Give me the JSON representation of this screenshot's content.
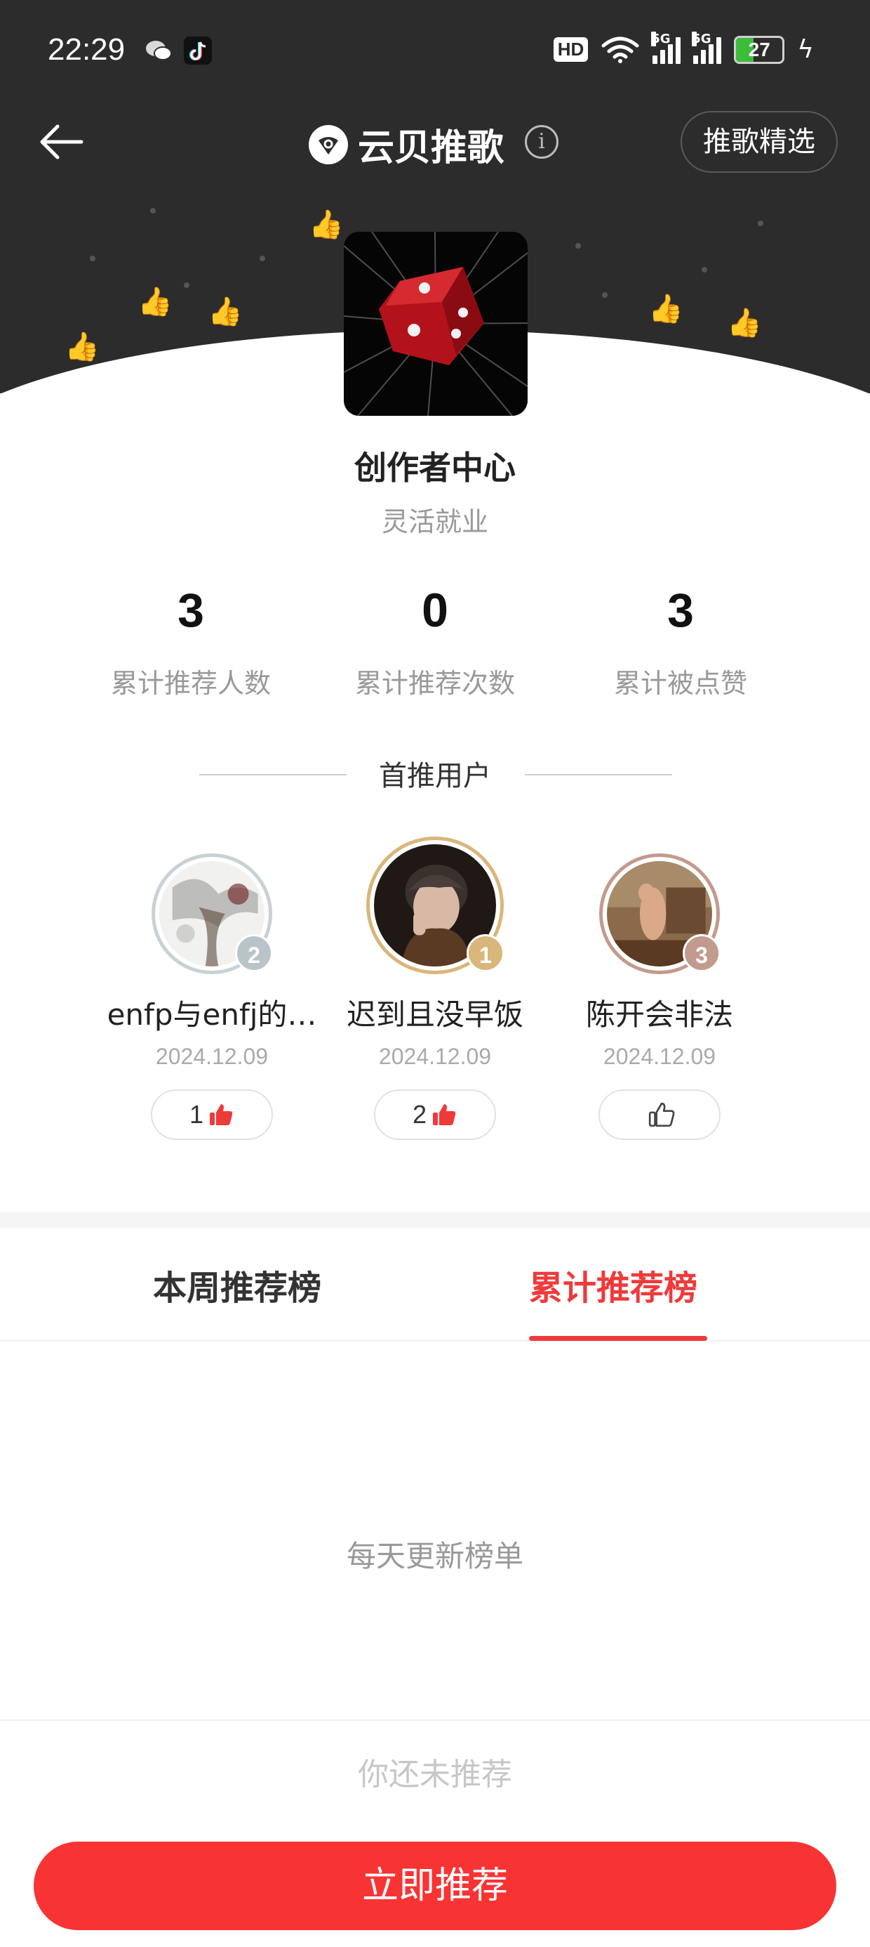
{
  "status_bar": {
    "time": "22:29",
    "hd_label": "HD",
    "network_1": "5G",
    "network_2": "5G",
    "battery": "27"
  },
  "nav": {
    "title": "云贝推歌",
    "pick_button": "推歌精选"
  },
  "creator": {
    "title": "创作者中心",
    "subtitle": "灵活就业"
  },
  "stats": [
    {
      "value": "3",
      "label": "累计推荐人数"
    },
    {
      "value": "0",
      "label": "累计推荐次数"
    },
    {
      "value": "3",
      "label": "累计被点赞"
    }
  ],
  "top_users_section": {
    "title": "首推用户"
  },
  "top_users": [
    {
      "rank": "2",
      "name": "enfp与enfj的…",
      "date": "2024.12.09",
      "likes": "1",
      "liked": true
    },
    {
      "rank": "1",
      "name": "迟到且没早饭",
      "date": "2024.12.09",
      "likes": "2",
      "liked": true
    },
    {
      "rank": "3",
      "name": "陈开会非法",
      "date": "2024.12.09",
      "likes": "",
      "liked": false
    }
  ],
  "tabs": {
    "week": "本周推荐榜",
    "total": "累计推荐榜"
  },
  "list": {
    "empty_text": "每天更新榜单"
  },
  "footer": {
    "status": "你还未推荐",
    "cta": "立即推荐"
  },
  "colors": {
    "accent": "#ef3a3a",
    "header_bg": "#2c2c2c",
    "rank_1": "#d9b679",
    "rank_2": "#b9c4c9",
    "rank_3": "#c39a8e"
  }
}
